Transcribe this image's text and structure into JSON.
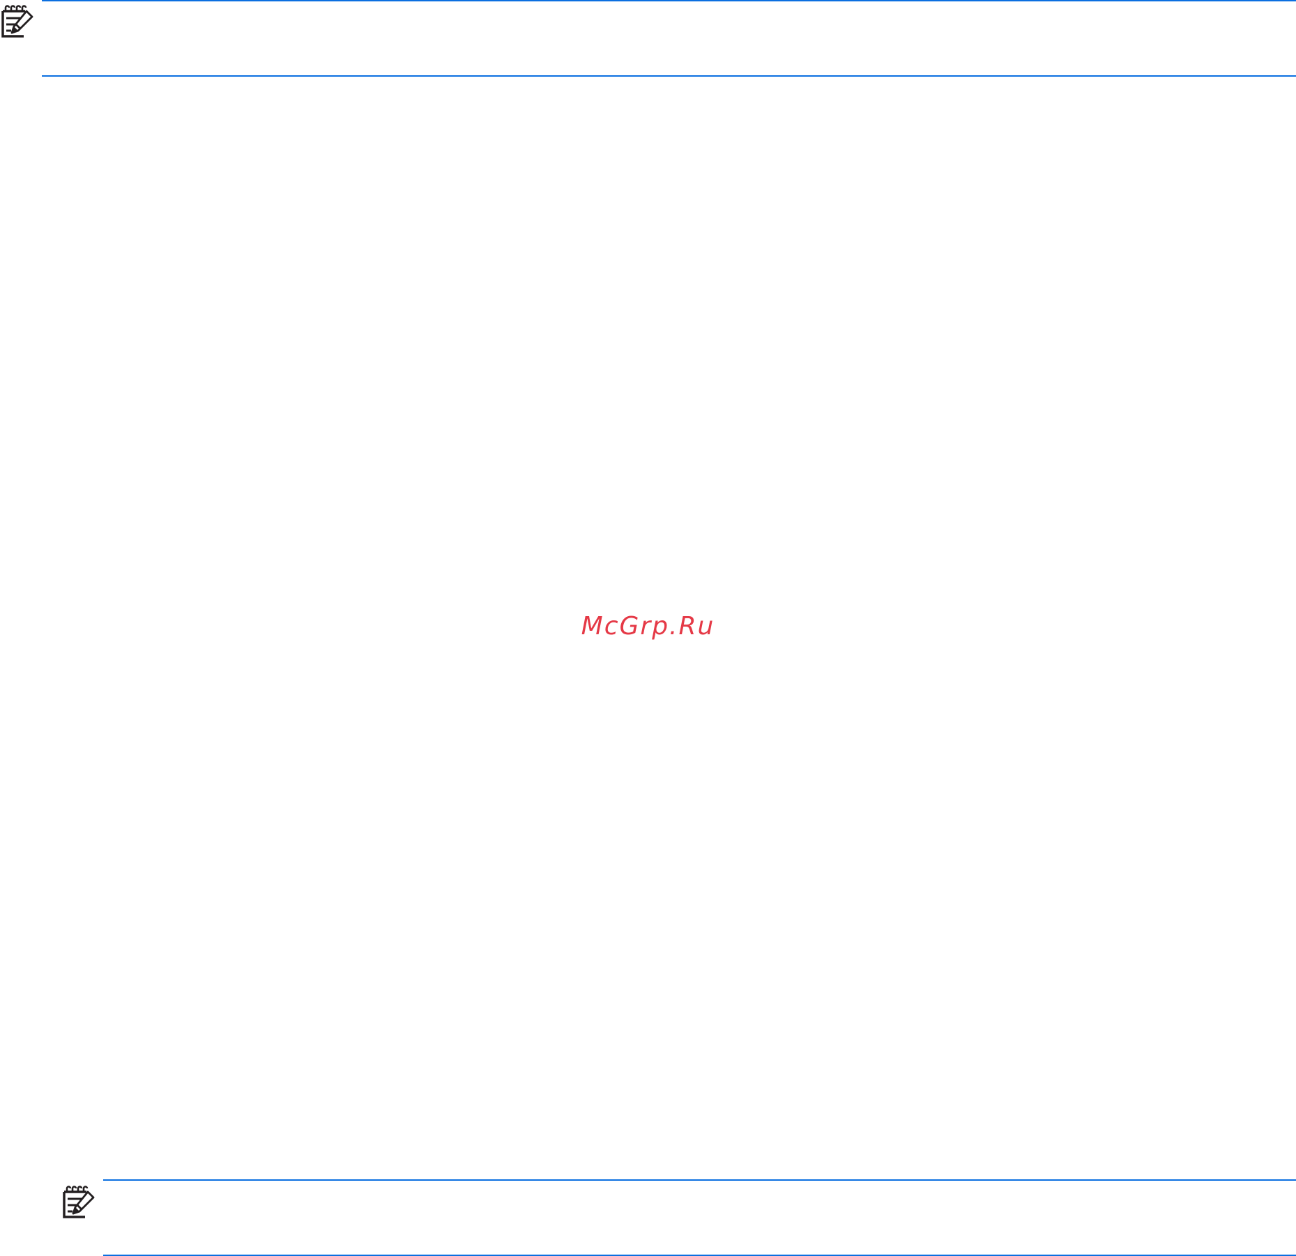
{
  "watermark": {
    "text": "McGrp.Ru",
    "color": "#e53946"
  },
  "colors": {
    "rule": "#0b6fe0",
    "icon": "#231f20"
  },
  "notes": [
    {
      "icon": "note-pad-icon"
    },
    {
      "icon": "note-pad-icon"
    }
  ]
}
